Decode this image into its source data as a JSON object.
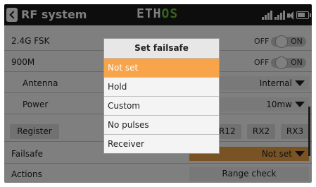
{
  "header": {
    "title": "RF system",
    "logo_left": "ETH",
    "logo_right": "OS",
    "icons": [
      "back-icon",
      "signal-icon",
      "signal-icon",
      "speaker-icon",
      "battery-icon"
    ]
  },
  "rows": {
    "fsk": {
      "label": "2.4G FSK",
      "off": "OFF",
      "on": "ON"
    },
    "m900": {
      "label": "900M",
      "off": "OFF",
      "on": "ON"
    },
    "antenna": {
      "label": "Antenna",
      "value": "Internal"
    },
    "power": {
      "label": "Power",
      "value": "10mw"
    },
    "register": {
      "button": "Register",
      "rx1": "SR12",
      "rx2": "RX2",
      "rx3": "RX3"
    },
    "failsafe": {
      "label": "Failsafe",
      "value": "Not set"
    },
    "actions": {
      "label": "Actions",
      "button": "Range check"
    }
  },
  "modal": {
    "title": "Set failsafe",
    "options": [
      "Not set",
      "Hold",
      "Custom",
      "No pulses",
      "Receiver"
    ],
    "selected": "Not set"
  },
  "colors": {
    "accent": "#f7a44a",
    "header": "#1b1b1b",
    "logo_green": "#6cc630"
  }
}
